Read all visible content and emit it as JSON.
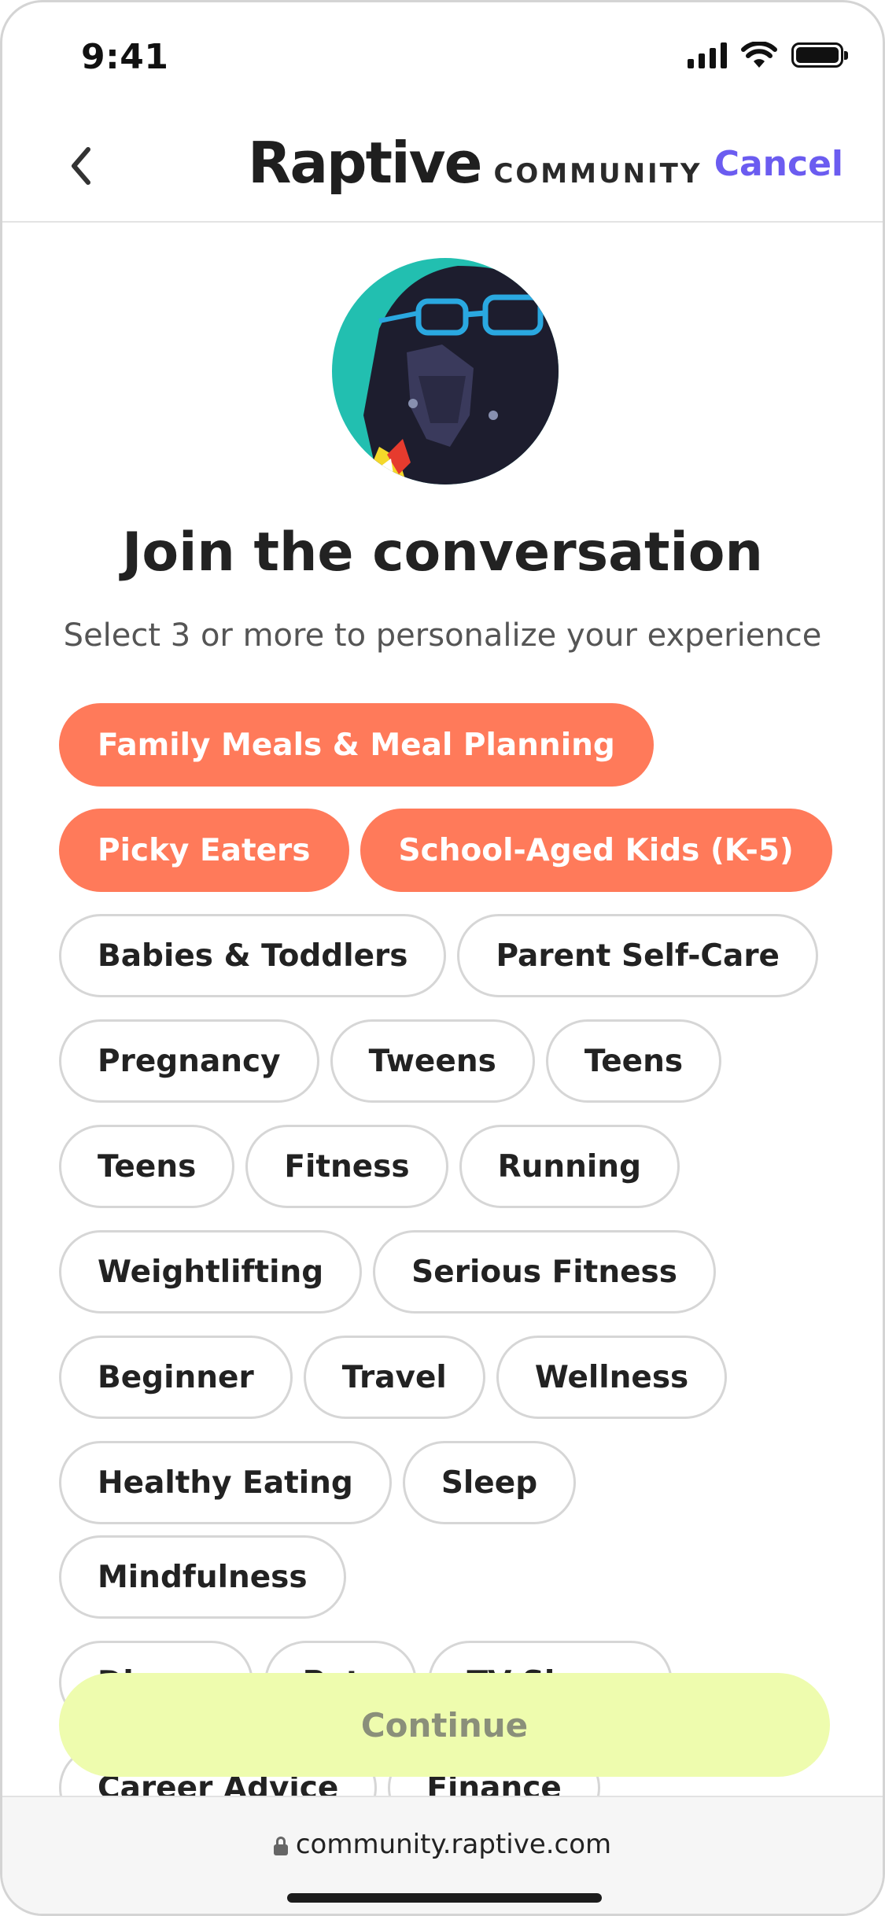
{
  "status_bar": {
    "time": "9:41",
    "icons": [
      "signal-icon",
      "wifi-icon",
      "battery-icon"
    ]
  },
  "header": {
    "back_icon": "chevron-left-icon",
    "logo_word": "Raptive",
    "logo_sub": "COMMUNITY",
    "cancel_label": "Cancel"
  },
  "avatar": {
    "icon": "avatar-image",
    "colors": {
      "background": "#22bfb0",
      "helmet": "#1d1d2e",
      "glasses": "#2aa8e0"
    }
  },
  "main": {
    "title": "Join the conversation",
    "subtitle": "Select 3 or more to personalize your experience",
    "topics": [
      {
        "label": "Family Meals & Meal Planning",
        "selected": true
      },
      {
        "label": "Picky Eaters",
        "selected": true
      },
      {
        "label": "School-Aged Kids (K-5)",
        "selected": true
      },
      {
        "label": "Babies & Toddlers",
        "selected": false
      },
      {
        "label": "Parent Self-Care",
        "selected": false
      },
      {
        "label": "Pregnancy",
        "selected": false
      },
      {
        "label": "Tweens",
        "selected": false
      },
      {
        "label": "Teens",
        "selected": false
      },
      {
        "label": "Teens",
        "selected": false
      },
      {
        "label": "Fitness",
        "selected": false
      },
      {
        "label": "Running",
        "selected": false
      },
      {
        "label": "Weightlifting",
        "selected": false
      },
      {
        "label": "Serious Fitness",
        "selected": false
      },
      {
        "label": "Beginner",
        "selected": false
      },
      {
        "label": "Travel",
        "selected": false
      },
      {
        "label": "Wellness",
        "selected": false
      },
      {
        "label": "Healthy Eating",
        "selected": false
      },
      {
        "label": "Sleep",
        "selected": false
      },
      {
        "label": "Mindfulness",
        "selected": false
      },
      {
        "label": "Disney",
        "selected": false
      },
      {
        "label": "Pets",
        "selected": false
      },
      {
        "label": "TV Shows",
        "selected": false
      },
      {
        "label": "Career Advice",
        "selected": false
      },
      {
        "label": "Finance",
        "selected": false
      }
    ],
    "continue_label": "Continue"
  },
  "browser": {
    "url": "community.raptive.com",
    "icon": "lock-icon"
  },
  "colors": {
    "accent": "#6b5cf0",
    "selected_chip": "#ff7a5a",
    "continue_bg": "#eefcae"
  }
}
